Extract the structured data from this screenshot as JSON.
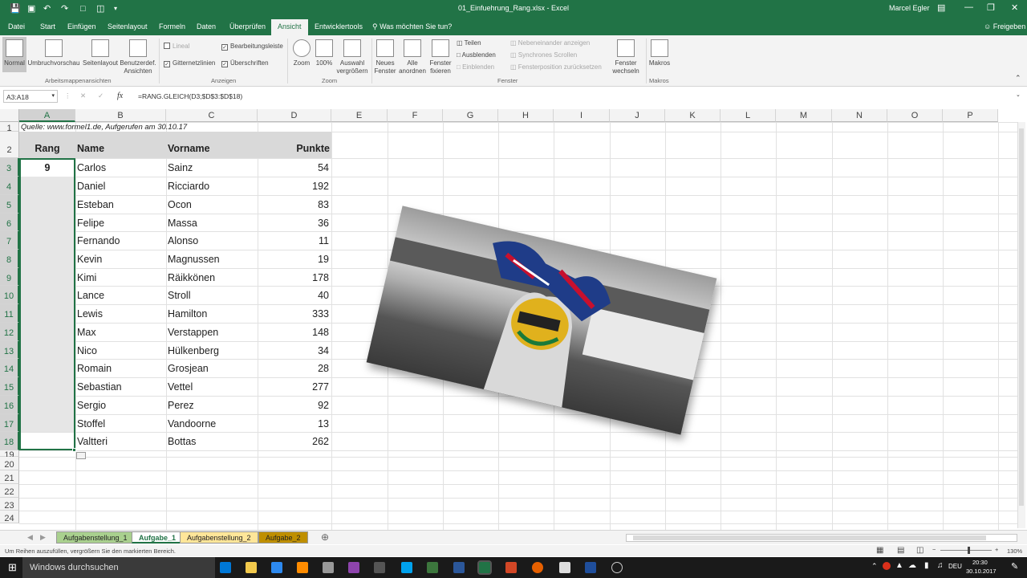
{
  "window": {
    "title": "01_Einfuehrung_Rang.xlsx - Excel",
    "user": "Marcel Egler"
  },
  "ribbon_tabs": [
    "Datei",
    "Start",
    "Einfügen",
    "Seitenlayout",
    "Formeln",
    "Daten",
    "Überprüfen",
    "Ansicht",
    "Entwicklertools"
  ],
  "active_tab": "Ansicht",
  "tell_me": "Was möchten Sie tun?",
  "share": "Freigeben",
  "ribbon": {
    "views": {
      "normal": "Normal",
      "pagebreak": "Umbruchvorschau",
      "pagelayout": "Seitenlayout",
      "custom": "Benutzerdef. Ansichten",
      "group": "Arbeitsmappenansichten"
    },
    "show": {
      "lineal": "Lineal",
      "formelbar": "Bearbeitungsleiste",
      "gitter": "Gitternetzlinien",
      "ueberschriften": "Überschriften",
      "group": "Anzeigen"
    },
    "zoom": {
      "zoom": "Zoom",
      "p100": "100%",
      "sel": "Auswahl vergrößern",
      "group": "Zoom"
    },
    "window": {
      "neu": "Neues Fenster",
      "alle": "Alle anordnen",
      "fix": "Fenster fixieren",
      "teilen": "Teilen",
      "aus": "Ausblenden",
      "ein": "Einblenden",
      "neben": "Nebeneinander anzeigen",
      "sync": "Synchrones Scrollen",
      "pos": "Fensterposition zurücksetzen",
      "wech": "Fenster wechseln",
      "group": "Fenster"
    },
    "macros": {
      "label": "Makros",
      "group": "Makros"
    }
  },
  "formula_bar": {
    "name_box": "A3:A18",
    "formula": "=RANG.GLEICH(D3;$D$3:$D$18)"
  },
  "columns": [
    "A",
    "B",
    "C",
    "D",
    "E",
    "F",
    "G",
    "H",
    "I",
    "J",
    "K",
    "L",
    "M",
    "N",
    "O",
    "P"
  ],
  "rows": [
    "1",
    "2",
    "3",
    "4",
    "5",
    "6",
    "7",
    "8",
    "9",
    "10",
    "11",
    "12",
    "13",
    "14",
    "15",
    "16",
    "17",
    "18",
    "19",
    "20",
    "21",
    "22",
    "23",
    "24"
  ],
  "source_note": "Quelle: www.formel1.de, Aufgerufen am 30.10.17",
  "table": {
    "headers": [
      "Rang",
      "Name",
      "Vorname",
      "Punkte"
    ],
    "rang_value": "9",
    "rows": [
      [
        "Carlos",
        "Sainz",
        "54"
      ],
      [
        "Daniel",
        "Ricciardo",
        "192"
      ],
      [
        "Esteban",
        "Ocon",
        "83"
      ],
      [
        "Felipe",
        "Massa",
        "36"
      ],
      [
        "Fernando",
        "Alonso",
        "11"
      ],
      [
        "Kevin",
        "Magnussen",
        "19"
      ],
      [
        "Kimi",
        "Räikkönen",
        "178"
      ],
      [
        "Lance",
        "Stroll",
        "40"
      ],
      [
        "Lewis",
        "Hamilton",
        "333"
      ],
      [
        "Max",
        "Verstappen",
        "148"
      ],
      [
        "Nico",
        "Hülkenberg",
        "34"
      ],
      [
        "Romain",
        "Grosjean",
        "28"
      ],
      [
        "Sebastian",
        "Vettel",
        "277"
      ],
      [
        "Sergio",
        "Perez",
        "92"
      ],
      [
        "Stoffel",
        "Vandoorne",
        "13"
      ],
      [
        "Valtteri",
        "Bottas",
        "262"
      ]
    ]
  },
  "sheets": [
    {
      "name": "Aufgabenstellung_1",
      "color": "#a9d08e"
    },
    {
      "name": "Aufgabe_1",
      "color": "#e2efda"
    },
    {
      "name": "Aufgabenstellung_2",
      "color": "#ffe699"
    },
    {
      "name": "Aufgabe_2",
      "color": "#bf8f00"
    }
  ],
  "active_sheet": "Aufgabe_1",
  "status": {
    "message": "Um Reihen auszufüllen, vergrößern Sie den markierten Bereich.",
    "zoom": "130%"
  },
  "taskbar": {
    "search": "Windows durchsuchen",
    "time": "20:30",
    "date": "30.10.2017",
    "lang": "DEU"
  },
  "colors": {
    "excel_green": "#217346",
    "header_fill": "#d9d9d9",
    "selection": "#217346"
  }
}
